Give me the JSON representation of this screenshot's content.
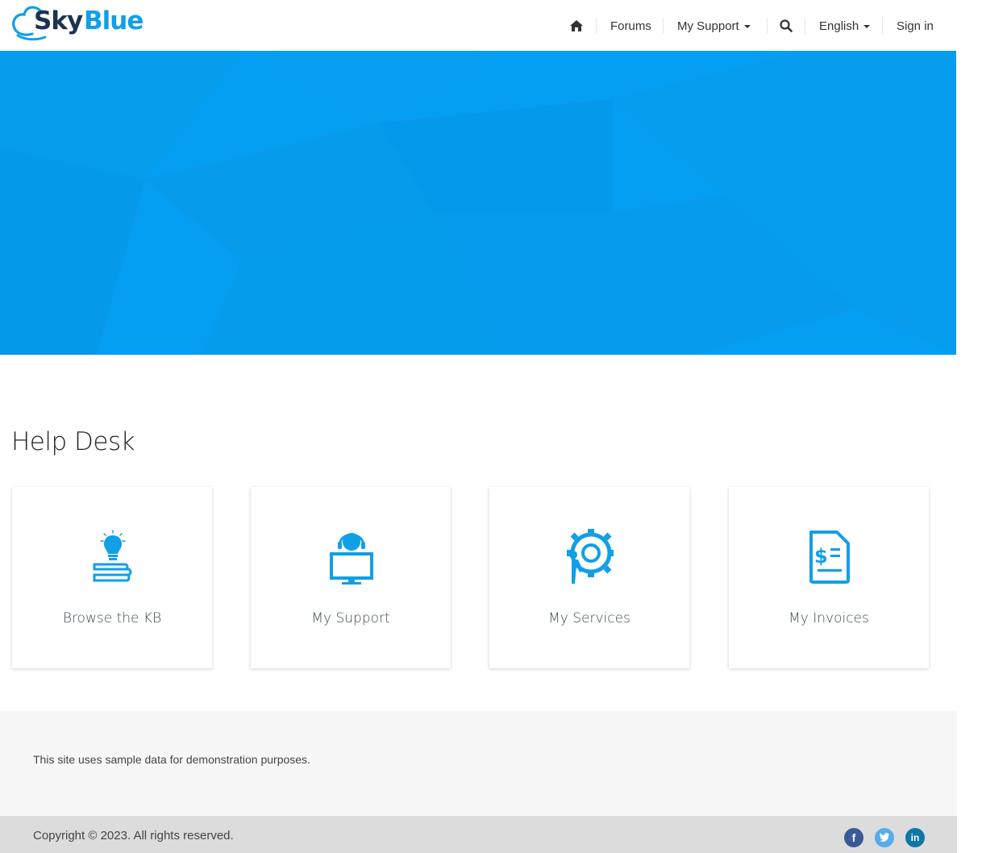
{
  "brand": {
    "part1": "Sky",
    "part2": "Blue",
    "color_dark": "#1b3350",
    "color_accent": "#119fe7"
  },
  "nav": {
    "home_icon": "home-icon",
    "forums": "Forums",
    "my_support": "My Support",
    "search_icon": "search-icon",
    "language": "English",
    "sign_in": "Sign in"
  },
  "hero": {
    "color": "#049ef2"
  },
  "main": {
    "title": "Help Desk",
    "cards": [
      {
        "label": "Browse the KB",
        "icon": "lightbulb-books-icon"
      },
      {
        "label": "My Support",
        "icon": "support-agent-monitor-icon"
      },
      {
        "label": "My Services",
        "icon": "gear-person-icon"
      },
      {
        "label": "My Invoices",
        "icon": "invoice-dollar-icon"
      }
    ]
  },
  "footer": {
    "note": "This site uses sample data for demonstration purposes.",
    "copyright": "Copyright © 2023. All rights reserved.",
    "social": [
      {
        "icon": "facebook-icon",
        "glyph": "f",
        "color": "#3b5998"
      },
      {
        "icon": "twitter-icon",
        "glyph": "t",
        "color": "#55acee"
      },
      {
        "icon": "linkedin-icon",
        "glyph": "in",
        "color": "#0e76a8"
      }
    ]
  }
}
